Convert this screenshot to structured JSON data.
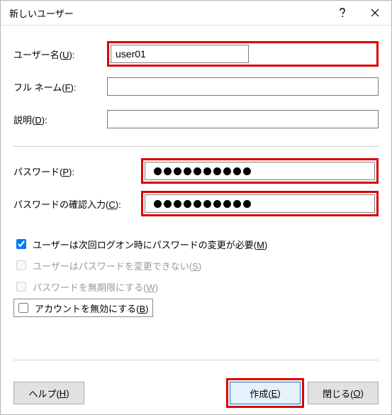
{
  "window": {
    "title": "新しいユーザー"
  },
  "labels": {
    "username_pre": "ユーザー名(",
    "username_hot": "U",
    "fullname_pre": "フル ネーム(",
    "fullname_hot": "F",
    "description_pre": "説明(",
    "description_hot": "D",
    "password_pre": "パスワード(",
    "password_hot": "P",
    "confirm_pre": "パスワードの確認入力(",
    "confirm_hot": "C",
    "close_paren_colon": "):"
  },
  "values": {
    "username": "user01",
    "fullname": "",
    "description": "",
    "password_dots": 10,
    "confirm_dots": 10
  },
  "checkboxes": {
    "must_change_pre": "ユーザーは次回ログオン時にパスワードの変更が必要(",
    "must_change_hot": "M",
    "must_change_post": ")",
    "cannot_change_pre": "ユーザーはパスワードを変更できない(",
    "cannot_change_hot": "S",
    "cannot_change_post": ")",
    "never_expires_pre": "パスワードを無期限にする(",
    "never_expires_hot": "W",
    "never_expires_post": ")",
    "disable_account_pre": "アカウントを無効にする(",
    "disable_account_hot": "B",
    "disable_account_post": ")"
  },
  "buttons": {
    "help_pre": "ヘルプ(",
    "help_hot": "H",
    "help_post": ")",
    "create_pre": "作成(",
    "create_hot": "E",
    "create_post": ")",
    "close_pre": "閉じる(",
    "close_hot": "O",
    "close_post": ")"
  }
}
